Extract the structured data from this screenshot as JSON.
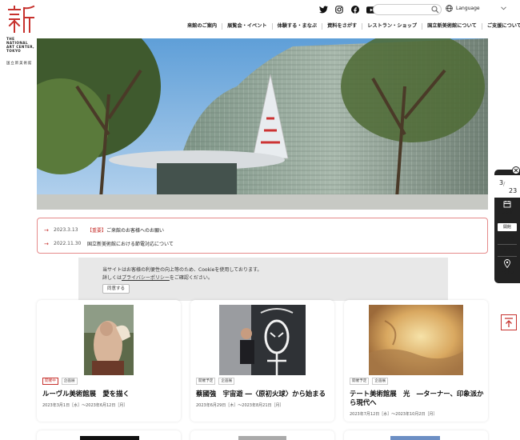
{
  "brand": {
    "mark": "新",
    "name_en": "THE\nNATIONAL\nART CENTER,\nTOKYO",
    "name_jp": "国立新美術館",
    "accent": "#c7322e"
  },
  "header": {
    "social_icons": [
      "twitter-icon",
      "instagram-icon",
      "facebook-icon",
      "youtube-icon"
    ],
    "search_placeholder": "",
    "language_label": "Language"
  },
  "nav": {
    "items": [
      {
        "label": "来館のご案内"
      },
      {
        "label": "展覧会・イベント"
      },
      {
        "label": "体験する・まなぶ"
      },
      {
        "label": "資料をさがす"
      },
      {
        "label": "レストラン・ショップ"
      },
      {
        "label": "国立新美術館について"
      },
      {
        "label": "ご支援について"
      }
    ]
  },
  "news": {
    "items": [
      {
        "date": "2023.3.13",
        "tag": "【重要】",
        "text": "ご来館のお客様へのお願い"
      },
      {
        "date": "2022.11.30",
        "tag": "",
        "text": "国立新美術館における節電対応について"
      }
    ]
  },
  "cookie": {
    "line1": "当サイトはお客様の利便性の向上等のため、Cookieを使用しております。",
    "line2_pre": "詳しくは",
    "line2_link": "プライバシーポリシー",
    "line2_post": "をご確認ください。",
    "button": "同意する"
  },
  "cards": [
    {
      "badges": [
        "開催中",
        "企画展"
      ],
      "title": "ルーヴル美術館展　愛を描く",
      "dates": "2023年3月1日［水］～2023年6月12日［月］"
    },
    {
      "badges": [
        "開催予定",
        "企画展"
      ],
      "title": "蔡國強　宇宙遊 ―〈原初火球〉から始まる",
      "dates": "2023年6月29日［木］～2023年8月21日［月］"
    },
    {
      "badges": [
        "開催予定",
        "企画展"
      ],
      "title": "テート美術館展　光　―ターナー、印象派から現代へ",
      "dates": "2023年7月12日［水］～2023年10月2日［月］"
    }
  ],
  "sidepanel": {
    "month": "3",
    "day": "23",
    "calendar_label": "カレンダー",
    "open_label": "開館",
    "time_open": "10:00",
    "time_close": "18:00",
    "access_label": "アクセス"
  }
}
